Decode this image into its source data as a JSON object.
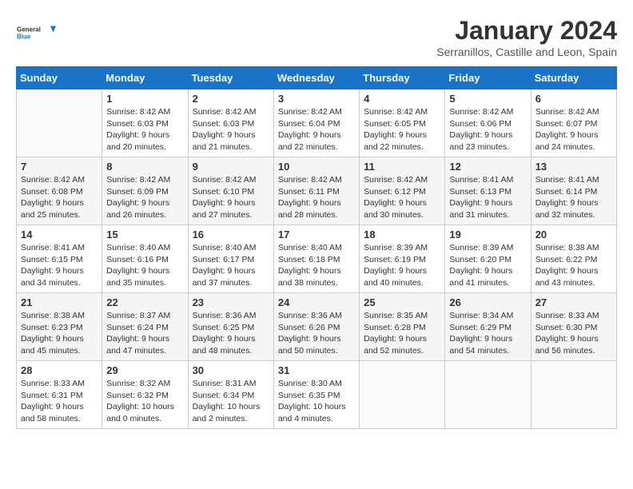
{
  "header": {
    "logo_line1": "General",
    "logo_line2": "Blue",
    "month_title": "January 2024",
    "subtitle": "Serranillos, Castille and Leon, Spain"
  },
  "weekdays": [
    "Sunday",
    "Monday",
    "Tuesday",
    "Wednesday",
    "Thursday",
    "Friday",
    "Saturday"
  ],
  "weeks": [
    [
      {
        "day": "",
        "info": ""
      },
      {
        "day": "1",
        "info": "Sunrise: 8:42 AM\nSunset: 6:03 PM\nDaylight: 9 hours\nand 20 minutes."
      },
      {
        "day": "2",
        "info": "Sunrise: 8:42 AM\nSunset: 6:03 PM\nDaylight: 9 hours\nand 21 minutes."
      },
      {
        "day": "3",
        "info": "Sunrise: 8:42 AM\nSunset: 6:04 PM\nDaylight: 9 hours\nand 22 minutes."
      },
      {
        "day": "4",
        "info": "Sunrise: 8:42 AM\nSunset: 6:05 PM\nDaylight: 9 hours\nand 22 minutes."
      },
      {
        "day": "5",
        "info": "Sunrise: 8:42 AM\nSunset: 6:06 PM\nDaylight: 9 hours\nand 23 minutes."
      },
      {
        "day": "6",
        "info": "Sunrise: 8:42 AM\nSunset: 6:07 PM\nDaylight: 9 hours\nand 24 minutes."
      }
    ],
    [
      {
        "day": "7",
        "info": "Sunrise: 8:42 AM\nSunset: 6:08 PM\nDaylight: 9 hours\nand 25 minutes."
      },
      {
        "day": "8",
        "info": "Sunrise: 8:42 AM\nSunset: 6:09 PM\nDaylight: 9 hours\nand 26 minutes."
      },
      {
        "day": "9",
        "info": "Sunrise: 8:42 AM\nSunset: 6:10 PM\nDaylight: 9 hours\nand 27 minutes."
      },
      {
        "day": "10",
        "info": "Sunrise: 8:42 AM\nSunset: 6:11 PM\nDaylight: 9 hours\nand 28 minutes."
      },
      {
        "day": "11",
        "info": "Sunrise: 8:42 AM\nSunset: 6:12 PM\nDaylight: 9 hours\nand 30 minutes."
      },
      {
        "day": "12",
        "info": "Sunrise: 8:41 AM\nSunset: 6:13 PM\nDaylight: 9 hours\nand 31 minutes."
      },
      {
        "day": "13",
        "info": "Sunrise: 8:41 AM\nSunset: 6:14 PM\nDaylight: 9 hours\nand 32 minutes."
      }
    ],
    [
      {
        "day": "14",
        "info": "Sunrise: 8:41 AM\nSunset: 6:15 PM\nDaylight: 9 hours\nand 34 minutes."
      },
      {
        "day": "15",
        "info": "Sunrise: 8:40 AM\nSunset: 6:16 PM\nDaylight: 9 hours\nand 35 minutes."
      },
      {
        "day": "16",
        "info": "Sunrise: 8:40 AM\nSunset: 6:17 PM\nDaylight: 9 hours\nand 37 minutes."
      },
      {
        "day": "17",
        "info": "Sunrise: 8:40 AM\nSunset: 6:18 PM\nDaylight: 9 hours\nand 38 minutes."
      },
      {
        "day": "18",
        "info": "Sunrise: 8:39 AM\nSunset: 6:19 PM\nDaylight: 9 hours\nand 40 minutes."
      },
      {
        "day": "19",
        "info": "Sunrise: 8:39 AM\nSunset: 6:20 PM\nDaylight: 9 hours\nand 41 minutes."
      },
      {
        "day": "20",
        "info": "Sunrise: 8:38 AM\nSunset: 6:22 PM\nDaylight: 9 hours\nand 43 minutes."
      }
    ],
    [
      {
        "day": "21",
        "info": "Sunrise: 8:38 AM\nSunset: 6:23 PM\nDaylight: 9 hours\nand 45 minutes."
      },
      {
        "day": "22",
        "info": "Sunrise: 8:37 AM\nSunset: 6:24 PM\nDaylight: 9 hours\nand 47 minutes."
      },
      {
        "day": "23",
        "info": "Sunrise: 8:36 AM\nSunset: 6:25 PM\nDaylight: 9 hours\nand 48 minutes."
      },
      {
        "day": "24",
        "info": "Sunrise: 8:36 AM\nSunset: 6:26 PM\nDaylight: 9 hours\nand 50 minutes."
      },
      {
        "day": "25",
        "info": "Sunrise: 8:35 AM\nSunset: 6:28 PM\nDaylight: 9 hours\nand 52 minutes."
      },
      {
        "day": "26",
        "info": "Sunrise: 8:34 AM\nSunset: 6:29 PM\nDaylight: 9 hours\nand 54 minutes."
      },
      {
        "day": "27",
        "info": "Sunrise: 8:33 AM\nSunset: 6:30 PM\nDaylight: 9 hours\nand 56 minutes."
      }
    ],
    [
      {
        "day": "28",
        "info": "Sunrise: 8:33 AM\nSunset: 6:31 PM\nDaylight: 9 hours\nand 58 minutes."
      },
      {
        "day": "29",
        "info": "Sunrise: 8:32 AM\nSunset: 6:32 PM\nDaylight: 10 hours\nand 0 minutes."
      },
      {
        "day": "30",
        "info": "Sunrise: 8:31 AM\nSunset: 6:34 PM\nDaylight: 10 hours\nand 2 minutes."
      },
      {
        "day": "31",
        "info": "Sunrise: 8:30 AM\nSunset: 6:35 PM\nDaylight: 10 hours\nand 4 minutes."
      },
      {
        "day": "",
        "info": ""
      },
      {
        "day": "",
        "info": ""
      },
      {
        "day": "",
        "info": ""
      }
    ]
  ]
}
